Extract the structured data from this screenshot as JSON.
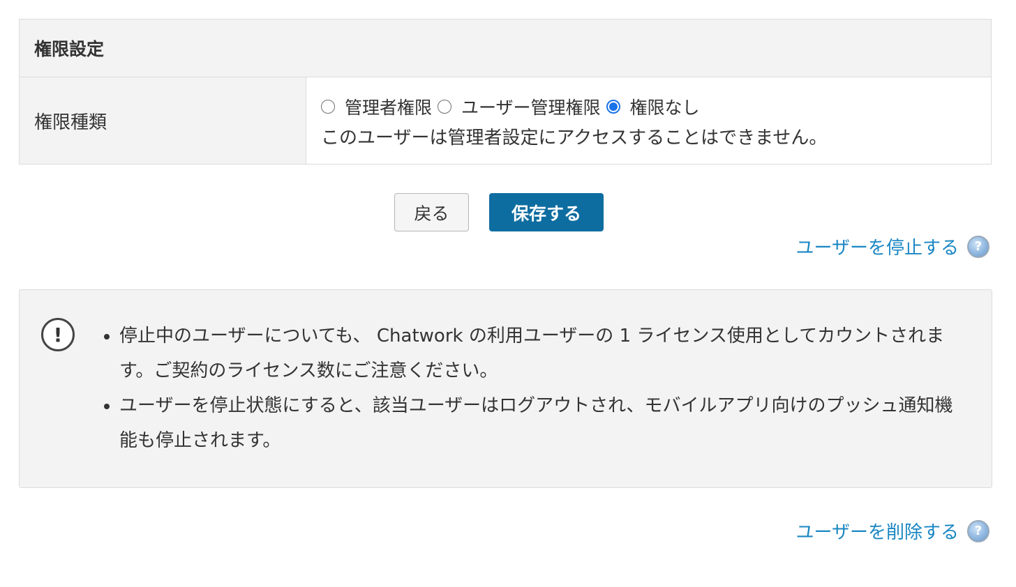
{
  "section": {
    "title": "権限設定"
  },
  "permission_row": {
    "label": "権限種類",
    "options": [
      {
        "label": "管理者権限",
        "selected": false
      },
      {
        "label": "ユーザー管理権限",
        "selected": false
      },
      {
        "label": "権限なし",
        "selected": true
      }
    ],
    "note": "このユーザーは管理者設定にアクセスすることはできません。"
  },
  "buttons": {
    "back_label": "戻る",
    "save_label": "保存する"
  },
  "links": {
    "stop_user": "ユーザーを停止する",
    "delete_user": "ユーザーを削除する",
    "help_icon": "help-icon"
  },
  "notice": {
    "icon": "exclamation-circle-icon",
    "items": [
      "停止中のユーザーについても、 Chatwork の利用ユーザーの 1 ライセンス使用としてカウントされます。ご契約のライセンス数にご注意ください。",
      "ユーザーを停止状態にすると、該当ユーザーはログアウトされ、モバイルアプリ向けのプッシュ通知機能も停止されます。"
    ]
  },
  "colors": {
    "accent": "#0e6da0",
    "link": "#1a87c3",
    "radio_checked": "#1a73e8",
    "panel_bg": "#f3f3f3",
    "border": "#dcdcdc"
  }
}
